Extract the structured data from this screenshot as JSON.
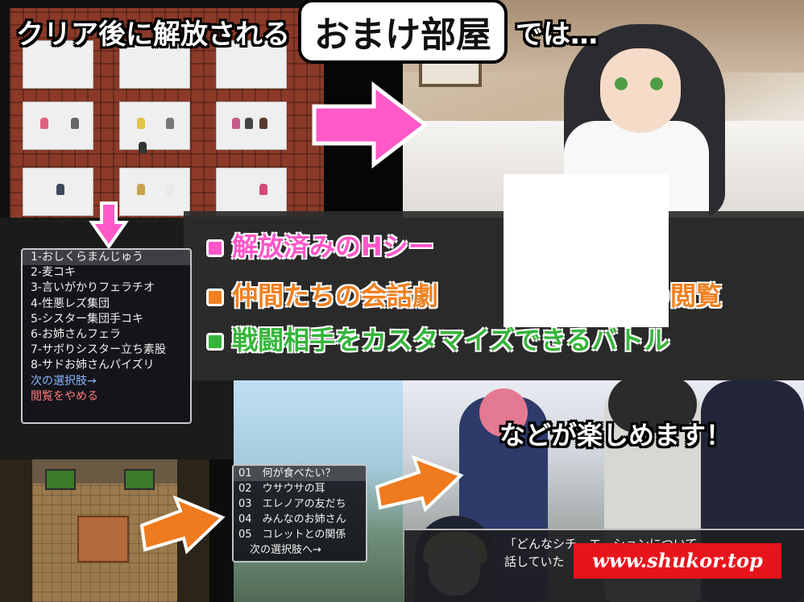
{
  "title": {
    "prefix": "クリア後に解放される",
    "highlight": "おまけ部屋",
    "suffix": "では…"
  },
  "features": [
    {
      "text": "解放済みのHシー",
      "color": "#ff56c8"
    },
    {
      "text": "仲間たちの会話劇　　　　　　　　の閲覧",
      "color": "#f08020"
    },
    {
      "text": "戦闘相手をカスタマイズできるバトル",
      "color": "#35b53a"
    }
  ],
  "replay_menu": {
    "items": [
      "1-おしくらまんじゅう",
      "2-麦コキ",
      "3-言いがかりフェラチオ",
      "4-性悪レズ集団",
      "5-シスター集団手コキ",
      "6-お姉さんフェラ",
      "7-サボりシスター立ち素股",
      "8-サドお姉さんパイズリ"
    ],
    "next": "次の選択肢→",
    "quit": "閲覧をやめる",
    "selected_index": 0
  },
  "talk_menu": {
    "items": [
      {
        "num": "01",
        "label": "何が食べたい？"
      },
      {
        "num": "02",
        "label": "ウサウサの耳"
      },
      {
        "num": "03",
        "label": "エレノアの友だち"
      },
      {
        "num": "04",
        "label": "みんなのお姉さん"
      },
      {
        "num": "05",
        "label": "コレットとの関係"
      }
    ],
    "next": "次の選択肢へ→",
    "selected_index": 0
  },
  "enjoy_text": "などが楽しめます！",
  "dialog": {
    "line1": "「どんなシチ　エ　ションについて",
    "line2": "話していた"
  },
  "watermark": "www.shukor.top",
  "colors": {
    "pink_arrow": "#ff5ac8",
    "orange_arrow": "#f07a1e",
    "watermark_bg": "#e8141c"
  }
}
